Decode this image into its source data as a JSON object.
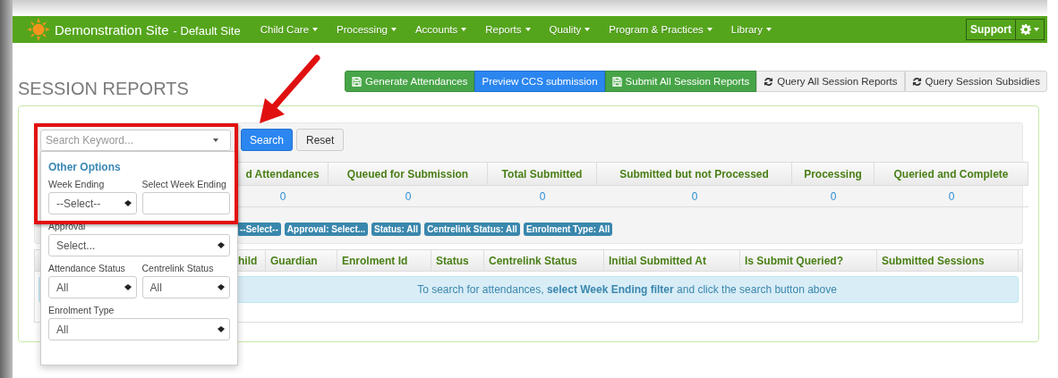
{
  "nav": {
    "brand": "Demonstration Site",
    "site": "- Default Site",
    "menu": [
      {
        "label": "Child Care"
      },
      {
        "label": "Processing"
      },
      {
        "label": "Accounts"
      },
      {
        "label": "Reports"
      },
      {
        "label": "Quality"
      },
      {
        "label": "Program & Practices"
      },
      {
        "label": "Library"
      }
    ],
    "support": "Support"
  },
  "title": "SESSION REPORTS",
  "actions": [
    {
      "label": "Generate Attendances",
      "kind": "save"
    },
    {
      "label": "Preview CCS submission",
      "kind": "primary"
    },
    {
      "label": "Submit All Session Reports",
      "kind": "save"
    },
    {
      "label": "Query All Session Reports",
      "kind": "query"
    },
    {
      "label": "Query Session Subsidies",
      "kind": "query"
    }
  ],
  "search": {
    "placeholder": "Search Keyword...",
    "search_button": "Search",
    "reset_button": "Reset"
  },
  "summary": {
    "columns": [
      "d Attendances",
      "Queued for Submission",
      "Total Submitted",
      "Submitted but not Processed",
      "Processing",
      "Queried and Complete"
    ],
    "values": [
      "0",
      "0",
      "0",
      "0",
      "0",
      "0"
    ]
  },
  "chips": [
    "--Select--",
    "Approval: Select...",
    "Status: All",
    "Centrelink Status: All",
    "Enrolment Type: All"
  ],
  "results": {
    "columns": [
      "hild",
      "Guardian",
      "Enrolment Id",
      "Status",
      "Centrelink Status",
      "Initial Submitted At",
      "Is Submit Queried?",
      "Submitted Sessions"
    ],
    "message": "To search for attendances, **select Week Ending filter** and click the search button above"
  },
  "options": {
    "heading": "Other Options",
    "rows": [
      [
        {
          "label": "Week Ending",
          "kind": "select",
          "value": "--Select--"
        },
        {
          "label": "Select Week Ending",
          "kind": "input"
        }
      ],
      [
        {
          "label": "Approval",
          "kind": "select",
          "value": "Select..."
        }
      ],
      [
        {
          "label": "Attendance Status",
          "kind": "select",
          "value": "All"
        },
        {
          "label": "Centrelink Status",
          "kind": "select",
          "value": "All"
        }
      ],
      [
        {
          "label": "Enrolment Type",
          "kind": "select",
          "value": "All"
        }
      ]
    ]
  }
}
